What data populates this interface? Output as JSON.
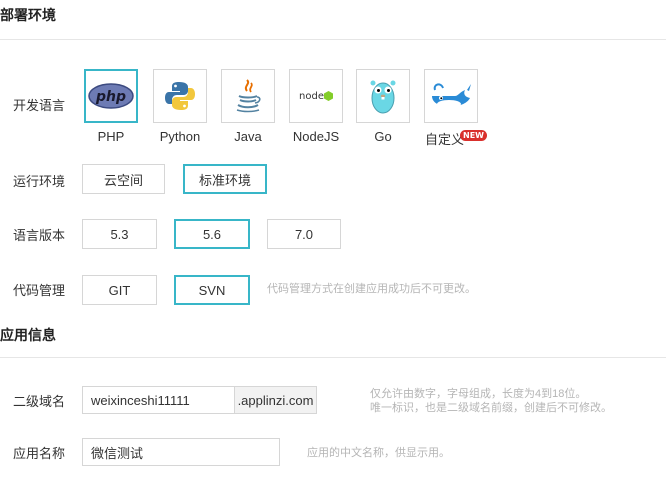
{
  "deploy": {
    "section_title": "部署环境",
    "lang_label": "开发语言",
    "languages": [
      {
        "name": "PHP",
        "icon": "php-icon",
        "selected": true
      },
      {
        "name": "Python",
        "icon": "python-icon",
        "selected": false
      },
      {
        "name": "Java",
        "icon": "java-icon",
        "selected": false
      },
      {
        "name": "NodeJS",
        "icon": "nodejs-icon",
        "selected": false
      },
      {
        "name": "Go",
        "icon": "go-gopher-icon",
        "selected": false
      },
      {
        "name": "自定义",
        "icon": "docker-whale-icon",
        "selected": false,
        "badge": "NEW"
      }
    ],
    "nodejs_logo_text": "node",
    "runtime_label": "运行环境",
    "runtime_options": [
      {
        "label": "云空间",
        "selected": false
      },
      {
        "label": "标准环境",
        "selected": true
      }
    ],
    "version_label": "语言版本",
    "version_options": [
      {
        "label": "5.3",
        "selected": false
      },
      {
        "label": "5.6",
        "selected": true
      },
      {
        "label": "7.0",
        "selected": false
      }
    ],
    "vcs_label": "代码管理",
    "vcs_options": [
      {
        "label": "GIT",
        "selected": false
      },
      {
        "label": "SVN",
        "selected": true
      }
    ],
    "vcs_hint": "代码管理方式在创建应用成功后不可更改。"
  },
  "app": {
    "section_title": "应用信息",
    "domain_label": "二级域名",
    "domain_value": "weixinceshi11111",
    "domain_suffix": ".applinzi.com",
    "domain_hint_1": "仅允许由数字，字母组成，长度为4到18位。",
    "domain_hint_2": "唯一标识，也是二级域名前缀，创建后不可修改。",
    "name_label": "应用名称",
    "name_value": "微信测试",
    "name_hint": "应用的中文名称，供显示用。"
  },
  "colors": {
    "selected_border": "#38b6c8",
    "badge_red": "#d9302c"
  }
}
